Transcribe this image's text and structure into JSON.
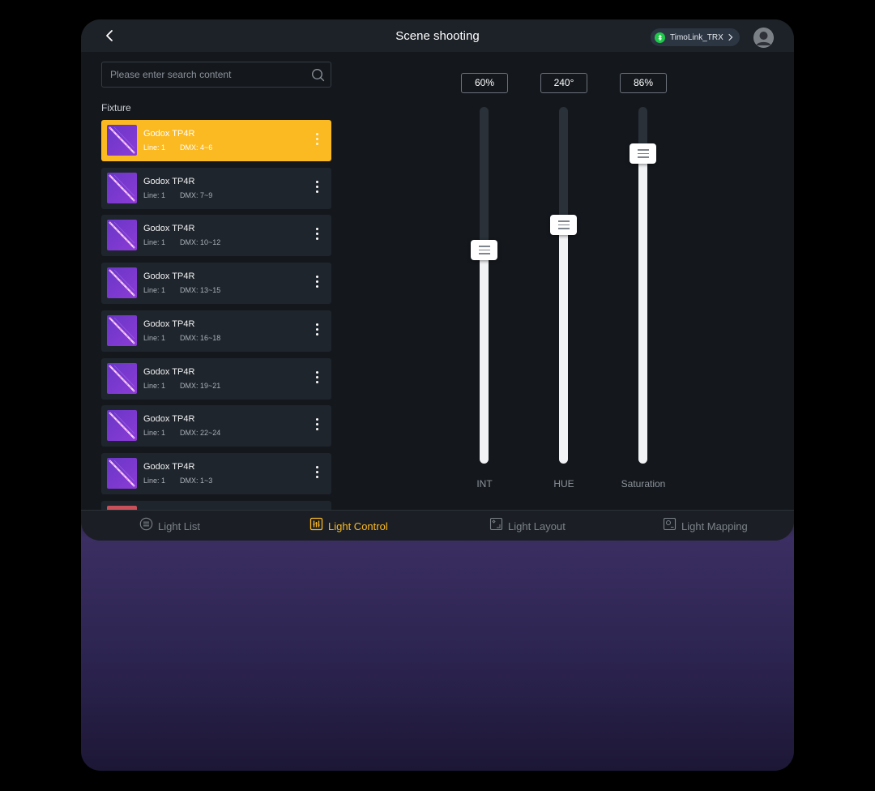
{
  "header": {
    "title": "Scene shooting",
    "device_name": "TimoLink_TRX"
  },
  "search": {
    "placeholder": "Please enter search content"
  },
  "fixture_section_label": "Fixture",
  "fixtures": [
    {
      "name": "Godox TP4R",
      "line": "Line: 1",
      "dmx": "DMX: 4~6",
      "active": true
    },
    {
      "name": "Godox TP4R",
      "line": "Line: 1",
      "dmx": "DMX: 7~9",
      "active": false
    },
    {
      "name": "Godox TP4R",
      "line": "Line: 1",
      "dmx": "DMX: 10~12",
      "active": false
    },
    {
      "name": "Godox TP4R",
      "line": "Line: 1",
      "dmx": "DMX: 13~15",
      "active": false
    },
    {
      "name": "Godox TP4R",
      "line": "Line: 1",
      "dmx": "DMX: 16~18",
      "active": false
    },
    {
      "name": "Godox TP4R",
      "line": "Line: 1",
      "dmx": "DMX: 19~21",
      "active": false
    },
    {
      "name": "Godox TP4R",
      "line": "Line: 1",
      "dmx": "DMX: 22~24",
      "active": false
    },
    {
      "name": "Godox TP4R",
      "line": "Line: 1",
      "dmx": "DMX: 1~3",
      "active": false
    }
  ],
  "sliders": [
    {
      "label": "INT",
      "value_text": "60%",
      "level": 0.6
    },
    {
      "label": "HUE",
      "value_text": "240°",
      "level": 0.67
    },
    {
      "label": "Saturation",
      "value_text": "86%",
      "level": 0.87
    }
  ],
  "tabs": [
    {
      "label": "Light List",
      "icon": "list-icon",
      "active": false
    },
    {
      "label": "Light Control",
      "icon": "control-icon",
      "active": true
    },
    {
      "label": "Light Layout",
      "icon": "layout-icon",
      "active": false
    },
    {
      "label": "Light Mapping",
      "icon": "mapping-icon",
      "active": false
    }
  ],
  "colors": {
    "accent": "#fbb922",
    "bluetooth": "#1ec94a",
    "background": "#14181d"
  }
}
